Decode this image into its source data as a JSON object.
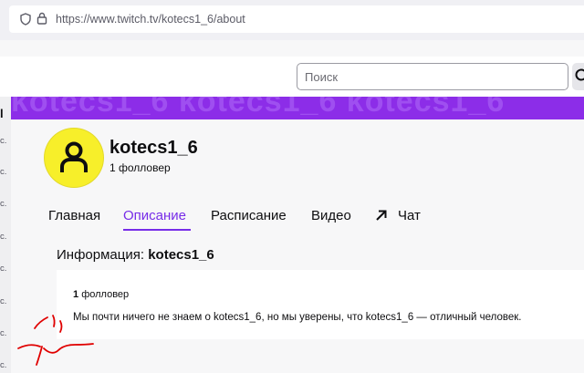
{
  "browser": {
    "url": "https://www.twitch.tv/kotecs1_6/about"
  },
  "topnav": {
    "search_placeholder": "Поиск"
  },
  "sidebar": {
    "collapse_glyph": "l",
    "item_suffix": "c."
  },
  "banner": {
    "text": "kotecs1_6 kotecs1_6 kotecs1_6"
  },
  "channel": {
    "name": "kotecs1_6",
    "followers": "1 фолловер",
    "avatar_color": "#f7ef2a"
  },
  "tabs": [
    {
      "label": "Главная",
      "active": false
    },
    {
      "label": "Описание",
      "active": true
    },
    {
      "label": "Расписание",
      "active": false
    },
    {
      "label": "Видео",
      "active": false
    },
    {
      "label": "Чат",
      "active": false
    }
  ],
  "about": {
    "heading_prefix": "Информация: ",
    "heading_name": "kotecs1_6",
    "followers_count": "1",
    "followers_word": "фолловер",
    "description": "Мы почти ничего не знаем о kotecs1_6, но мы уверены, что kotecs1_6 — отличный человек."
  },
  "colors": {
    "accent": "#772ce8",
    "banner": "#8c2de8",
    "annotation": "#e00000"
  }
}
